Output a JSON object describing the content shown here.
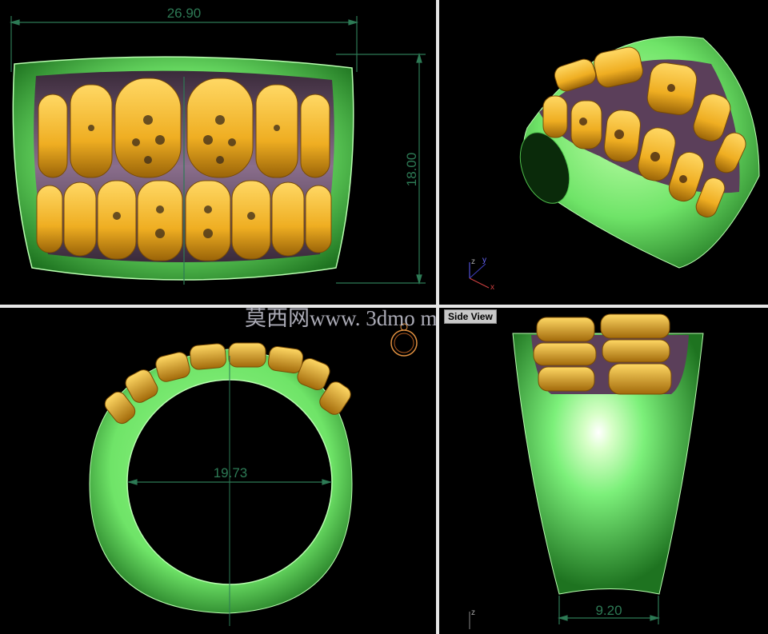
{
  "colors": {
    "ring_green": "#7CF07A",
    "ring_green_dark": "#1f7a22",
    "gold": "#F2B629",
    "gold_dark": "#8a5a07",
    "dimension": "#2d7a55",
    "divider": "#e6e6e6",
    "background": "#000000"
  },
  "views": {
    "top_left": {
      "dimension_width": "26.90",
      "dimension_height": "18.00"
    },
    "top_right": {
      "axis_x": "x",
      "axis_y": "y",
      "axis_z": "z"
    },
    "bottom_left": {
      "dimension_inner": "19.73"
    },
    "bottom_right": {
      "label": "Side View",
      "dimension_bottom": "9.20",
      "axis_z": "z"
    }
  },
  "watermark": "莫西网www. 3dmo   m"
}
